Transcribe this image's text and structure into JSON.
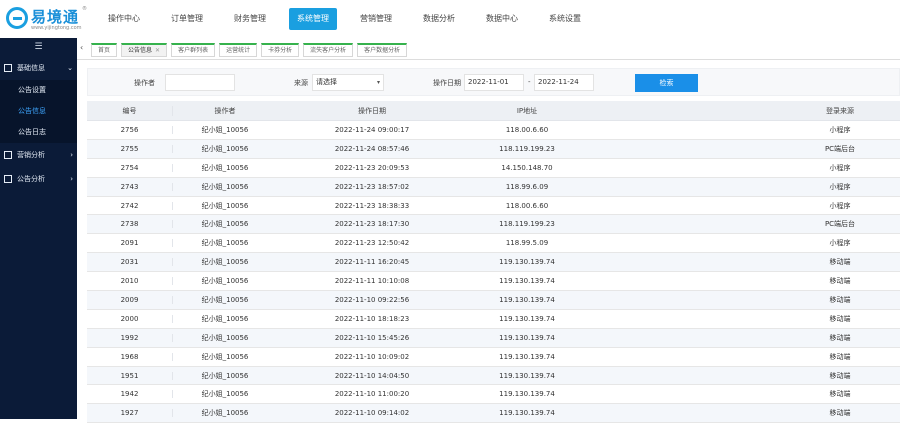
{
  "brand": {
    "name": "易境通",
    "url": "www.yijingtong.com",
    "reg": "®"
  },
  "nav": [
    {
      "label": "操作中心",
      "active": false
    },
    {
      "label": "订单管理",
      "active": false
    },
    {
      "label": "财务管理",
      "active": false
    },
    {
      "label": "系统管理",
      "active": true
    },
    {
      "label": "营销管理",
      "active": false
    },
    {
      "label": "数据分析",
      "active": false
    },
    {
      "label": "数据中心",
      "active": false
    },
    {
      "label": "系统设置",
      "active": false
    }
  ],
  "sidebar": {
    "toggle": "☰",
    "groups": [
      {
        "label": "基础信息",
        "chevron": "⌄",
        "subs": [
          {
            "label": "公告设置",
            "active": false
          },
          {
            "label": "公告信息",
            "active": true
          },
          {
            "label": "公告日志",
            "active": false
          }
        ]
      },
      {
        "label": "营销分析",
        "chevron": "›"
      },
      {
        "label": "公告分析",
        "chevron": "›"
      }
    ]
  },
  "tabs": {
    "arrow": "‹",
    "items": [
      {
        "label": "首页",
        "active": false,
        "closable": false
      },
      {
        "label": "公告信息",
        "active": true,
        "closable": true
      },
      {
        "label": "客户群列表",
        "active": false,
        "closable": false
      },
      {
        "label": "运营统计",
        "active": false,
        "closable": false
      },
      {
        "label": "卡券分析",
        "active": false,
        "closable": false
      },
      {
        "label": "流失客户分析",
        "active": false,
        "closable": false
      },
      {
        "label": "客户数据分析",
        "active": false,
        "closable": false
      }
    ],
    "close_glyph": "✕"
  },
  "filter": {
    "operator_label": "操作者",
    "operator_value": "",
    "source_label": "来源",
    "source_value": "请选择",
    "date_label": "操作日期",
    "date_start": "2022-11-01",
    "date_sep": "-",
    "date_end": "2022-11-24",
    "query_label": "检索"
  },
  "table": {
    "headers": [
      "编号",
      "操作者",
      "操作日期",
      "IP地址",
      "登录来源"
    ],
    "rows": [
      [
        "2756",
        "纪小姐_10056",
        "2022-11-24 09:00:17",
        "118.00.6.60",
        "小程序"
      ],
      [
        "2755",
        "纪小姐_10056",
        "2022-11-24 08:57:46",
        "118.119.199.23",
        "PC端后台"
      ],
      [
        "2754",
        "纪小姐_10056",
        "2022-11-23 20:09:53",
        "14.150.148.70",
        "小程序"
      ],
      [
        "2743",
        "纪小姐_10056",
        "2022-11-23 18:57:02",
        "118.99.6.09",
        "小程序"
      ],
      [
        "2742",
        "纪小姐_10056",
        "2022-11-23 18:38:33",
        "118.00.6.60",
        "小程序"
      ],
      [
        "2738",
        "纪小姐_10056",
        "2022-11-23 18:17:30",
        "118.119.199.23",
        "PC端后台"
      ],
      [
        "2091",
        "纪小姐_10056",
        "2022-11-23 12:50:42",
        "118.99.5.09",
        "小程序"
      ],
      [
        "2031",
        "纪小姐_10056",
        "2022-11-11 16:20:45",
        "119.130.139.74",
        "移动端"
      ],
      [
        "2010",
        "纪小姐_10056",
        "2022-11-11 10:10:08",
        "119.130.139.74",
        "移动端"
      ],
      [
        "2009",
        "纪小姐_10056",
        "2022-11-10 09:22:56",
        "119.130.139.74",
        "移动端"
      ],
      [
        "2000",
        "纪小姐_10056",
        "2022-11-10 18:18:23",
        "119.130.139.74",
        "移动端"
      ],
      [
        "1992",
        "纪小姐_10056",
        "2022-11-10 15:45:26",
        "119.130.139.74",
        "移动端"
      ],
      [
        "1968",
        "纪小姐_10056",
        "2022-11-10 10:09:02",
        "119.130.139.74",
        "移动端"
      ],
      [
        "1951",
        "纪小姐_10056",
        "2022-11-10 14:04:50",
        "119.130.139.74",
        "移动端"
      ],
      [
        "1942",
        "纪小姐_10056",
        "2022-11-10 11:00:20",
        "119.130.139.74",
        "移动端"
      ],
      [
        "1927",
        "纪小姐_10056",
        "2022-11-10 09:14:02",
        "119.130.139.74",
        "移动端"
      ]
    ]
  }
}
